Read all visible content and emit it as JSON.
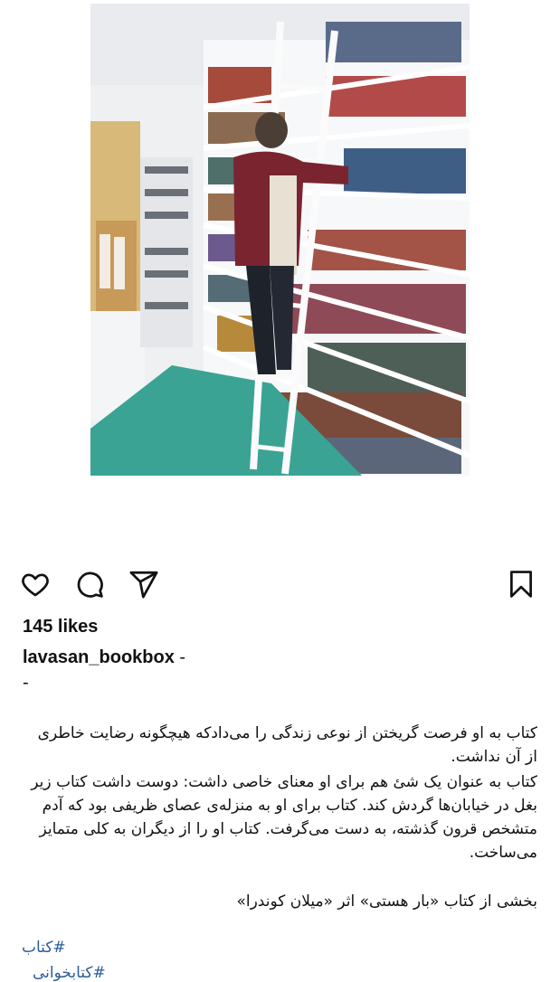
{
  "post": {
    "likes": "145 likes",
    "username": "lavasan_bookbox",
    "username_suffix": " -",
    "dash_line": "-",
    "caption_paragraphs": [
      "کتاب به او فرصت گریختن از نوعی زندگی را می‌دادکه هیچگونه رضایت خاطری از آن نداشت.",
      "کتاب به عنوان یک شئ هم برای او معنای خاصی داشت: دوست داشت کتاب زیر بغل در خیابان‌ها گردش کند. کتاب برای او به منزله‌ی عصای ظریفی بود که آدم متشخص قرون گذشته، به دست می‌گرفت. کتاب او را از دیگران به کلی متمایز می‌ساخت.",
      "بخشی از کتاب «بار هستی» اثر «میلان کوندرا»"
    ],
    "hashtags": [
      "#کتاب",
      "#کتابخوانی"
    ]
  },
  "icons": {
    "like": "heart-icon",
    "comment": "comment-bubble-icon",
    "share": "paper-plane-icon",
    "save": "bookmark-icon"
  },
  "colors": {
    "text": "#111111",
    "hashtag": "#2b5d9c",
    "floor": "#3aa394",
    "sweater": "#7a2430"
  }
}
